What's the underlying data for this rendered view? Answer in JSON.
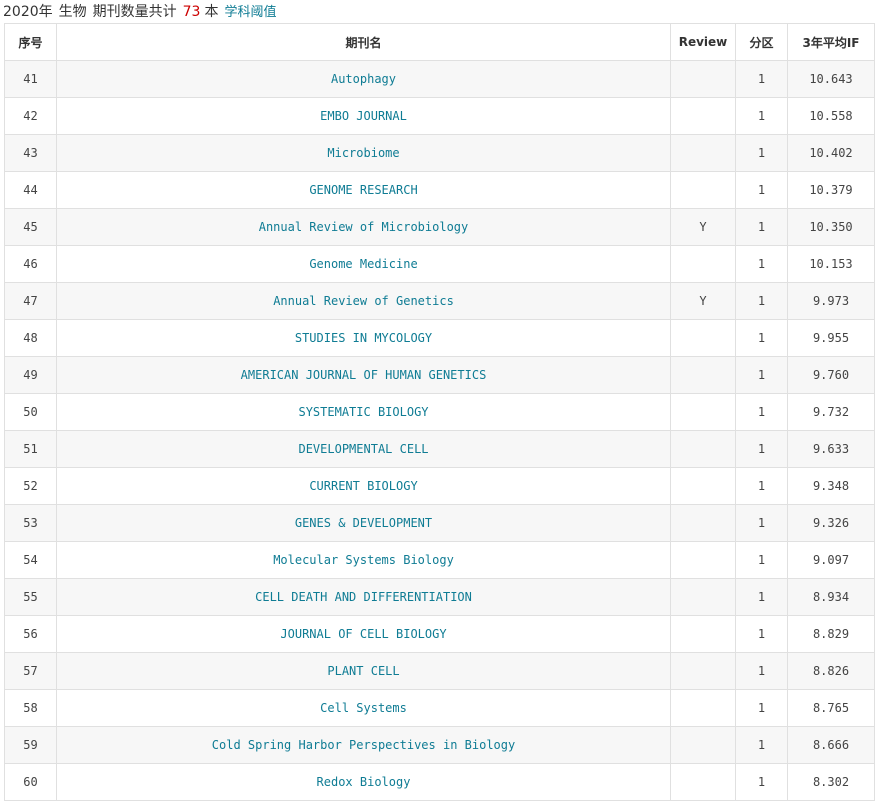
{
  "header": {
    "year": "2020年",
    "subject": "生物",
    "prefix": "期刊数量共计",
    "count": "73",
    "unit": "本",
    "threshold_link": "学科阈值"
  },
  "table": {
    "columns": [
      "序号",
      "期刊名",
      "Review",
      "分区",
      "3年平均IF"
    ],
    "rows": [
      {
        "no": "41",
        "name": "Autophagy",
        "review": "",
        "zone": "1",
        "if3": "10.643"
      },
      {
        "no": "42",
        "name": "EMBO JOURNAL",
        "review": "",
        "zone": "1",
        "if3": "10.558"
      },
      {
        "no": "43",
        "name": "Microbiome",
        "review": "",
        "zone": "1",
        "if3": "10.402"
      },
      {
        "no": "44",
        "name": "GENOME RESEARCH",
        "review": "",
        "zone": "1",
        "if3": "10.379"
      },
      {
        "no": "45",
        "name": "Annual Review of Microbiology",
        "review": "Y",
        "zone": "1",
        "if3": "10.350"
      },
      {
        "no": "46",
        "name": "Genome Medicine",
        "review": "",
        "zone": "1",
        "if3": "10.153"
      },
      {
        "no": "47",
        "name": "Annual Review of Genetics",
        "review": "Y",
        "zone": "1",
        "if3": "9.973"
      },
      {
        "no": "48",
        "name": "STUDIES IN MYCOLOGY",
        "review": "",
        "zone": "1",
        "if3": "9.955"
      },
      {
        "no": "49",
        "name": "AMERICAN JOURNAL OF HUMAN GENETICS",
        "review": "",
        "zone": "1",
        "if3": "9.760"
      },
      {
        "no": "50",
        "name": "SYSTEMATIC BIOLOGY",
        "review": "",
        "zone": "1",
        "if3": "9.732"
      },
      {
        "no": "51",
        "name": "DEVELOPMENTAL CELL",
        "review": "",
        "zone": "1",
        "if3": "9.633"
      },
      {
        "no": "52",
        "name": "CURRENT BIOLOGY",
        "review": "",
        "zone": "1",
        "if3": "9.348"
      },
      {
        "no": "53",
        "name": "GENES & DEVELOPMENT",
        "review": "",
        "zone": "1",
        "if3": "9.326"
      },
      {
        "no": "54",
        "name": "Molecular Systems Biology",
        "review": "",
        "zone": "1",
        "if3": "9.097"
      },
      {
        "no": "55",
        "name": "CELL DEATH AND DIFFERENTIATION",
        "review": "",
        "zone": "1",
        "if3": "8.934"
      },
      {
        "no": "56",
        "name": "JOURNAL OF CELL BIOLOGY",
        "review": "",
        "zone": "1",
        "if3": "8.829"
      },
      {
        "no": "57",
        "name": "PLANT CELL",
        "review": "",
        "zone": "1",
        "if3": "8.826"
      },
      {
        "no": "58",
        "name": "Cell Systems",
        "review": "",
        "zone": "1",
        "if3": "8.765"
      },
      {
        "no": "59",
        "name": "Cold Spring Harbor Perspectives in Biology",
        "review": "",
        "zone": "1",
        "if3": "8.666"
      },
      {
        "no": "60",
        "name": "Redox Biology",
        "review": "",
        "zone": "1",
        "if3": "8.302"
      }
    ]
  },
  "colors": {
    "link": "#0f7c94",
    "count": "#cc0000",
    "border": "#e0e0e0",
    "row_alt": "#f7f7f7"
  }
}
